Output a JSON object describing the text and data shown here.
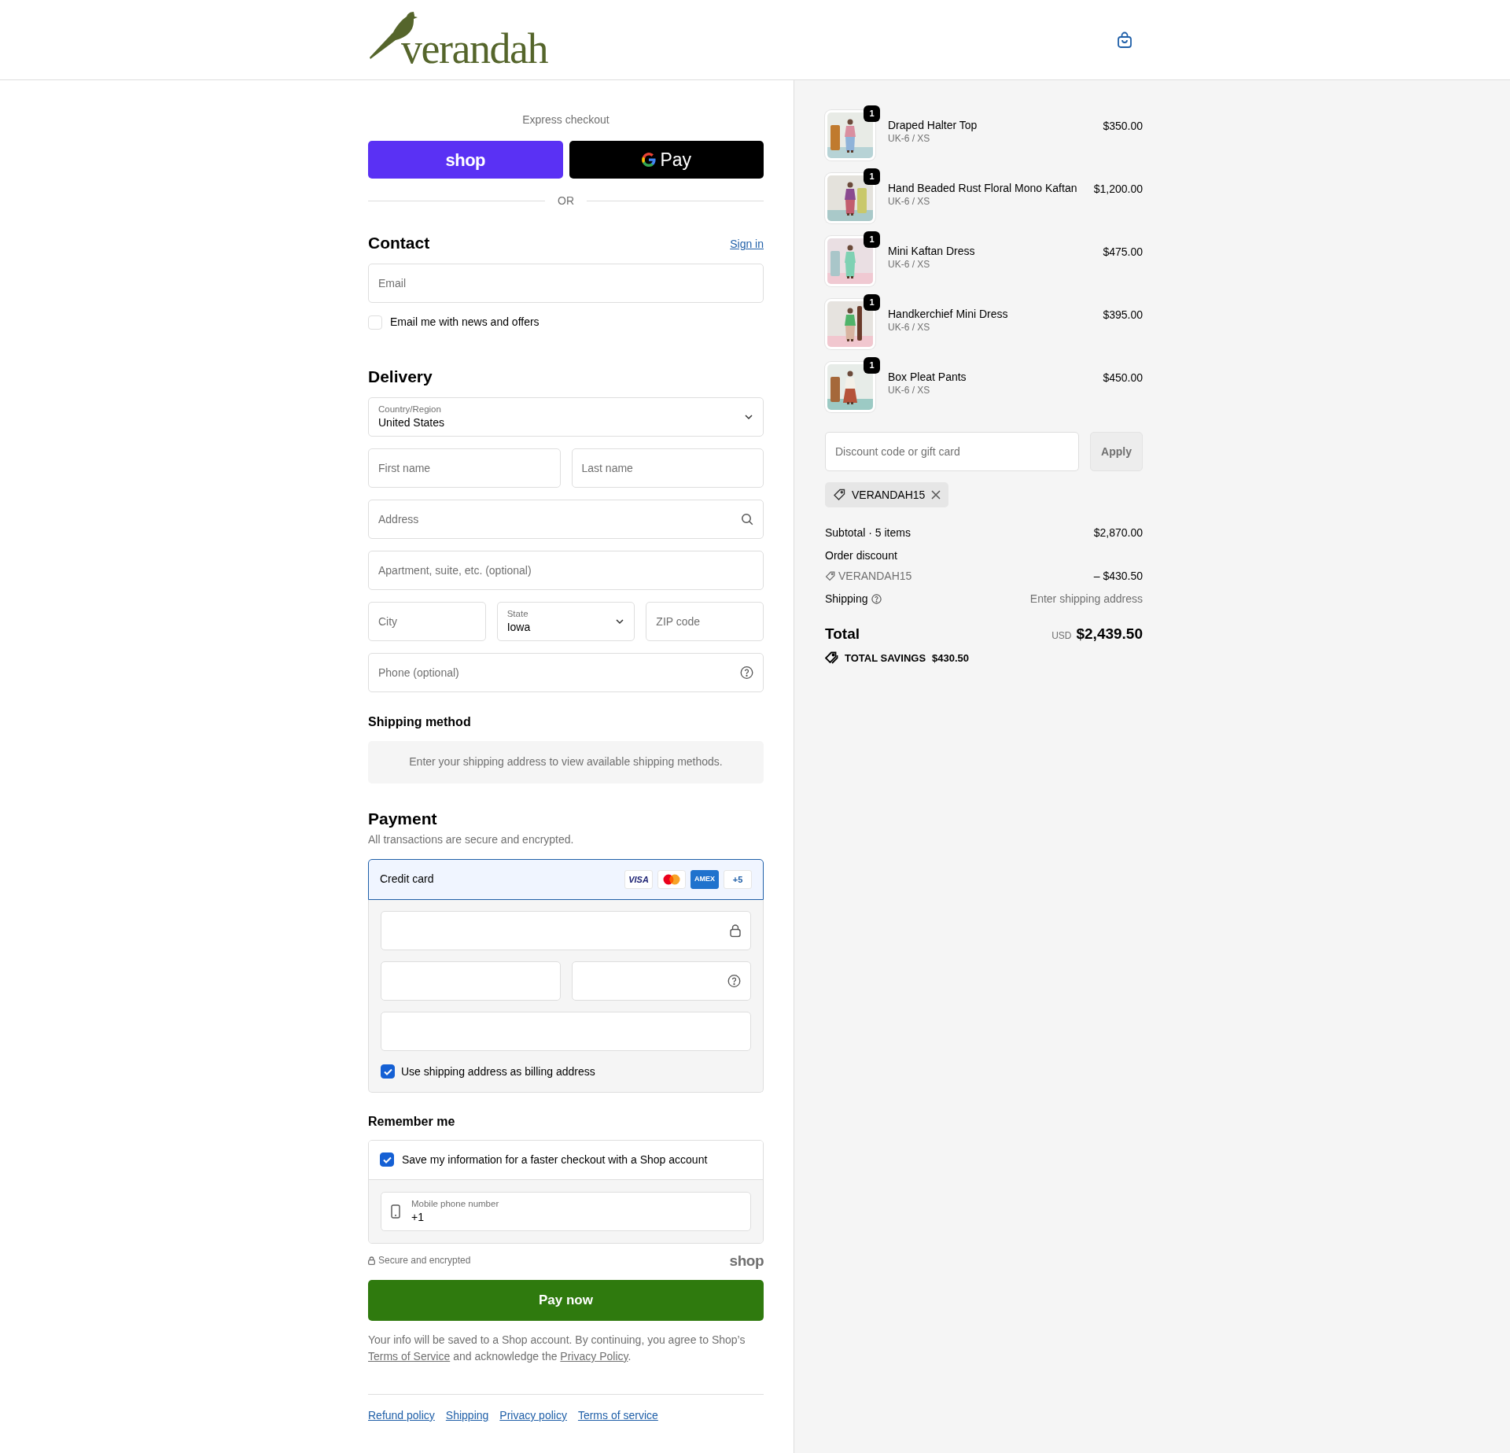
{
  "header": {
    "logo": "verandah"
  },
  "express_checkout": {
    "label": "Express checkout",
    "buttons": [
      {
        "kind": "shop",
        "label": "shop"
      },
      {
        "kind": "gpay",
        "label": "Pay"
      }
    ],
    "divider": "OR"
  },
  "contact": {
    "title": "Contact",
    "sign_in": "Sign in",
    "email": {
      "placeholder": "Email"
    },
    "newsletter": {
      "label": "Email me with news and offers",
      "checked": false
    }
  },
  "delivery": {
    "title": "Delivery",
    "rows": [
      [
        {
          "kind": "select",
          "label": "Country/Region",
          "value": "United States"
        }
      ],
      [
        {
          "kind": "text",
          "placeholder": "First name"
        },
        {
          "kind": "text",
          "placeholder": "Last name"
        }
      ],
      [
        {
          "kind": "search",
          "placeholder": "Address"
        }
      ],
      [
        {
          "kind": "text",
          "placeholder": "Apartment, suite, etc. (optional)"
        }
      ],
      [
        {
          "kind": "text",
          "placeholder": "City"
        },
        {
          "kind": "select",
          "label": "State",
          "value": "Iowa"
        },
        {
          "kind": "text",
          "placeholder": "ZIP code"
        }
      ],
      [
        {
          "kind": "help",
          "placeholder": "Phone (optional)"
        }
      ]
    ]
  },
  "shipping_method": {
    "title": "Shipping method",
    "message": "Enter your shipping address to view available shipping methods."
  },
  "payment": {
    "title": "Payment",
    "subtitle": "All transactions are secure and encrypted.",
    "method": {
      "label": "Credit card",
      "selected": true,
      "brands": [
        {
          "kind": "visa",
          "label": "VISA"
        },
        {
          "kind": "mastercard"
        },
        {
          "kind": "amex",
          "label": "AMEX"
        },
        {
          "kind": "more",
          "label": "+5"
        }
      ]
    },
    "card_fields": [
      [
        {
          "kind": "lock"
        }
      ],
      [
        {
          "kind": "plain"
        },
        {
          "kind": "help"
        }
      ],
      [
        {
          "kind": "plain"
        }
      ]
    ],
    "billing": {
      "label": "Use shipping address as billing address",
      "checked": true
    }
  },
  "remember_me": {
    "title": "Remember me",
    "save": {
      "label": "Save my information for a faster checkout with a Shop account",
      "checked": true
    },
    "phone": {
      "label": "Mobile phone number",
      "value": "+1"
    },
    "secure": "Secure and encrypted",
    "shop_mark": "shop"
  },
  "pay_button": "Pay now",
  "legal": [
    {
      "kind": "text",
      "text": "Your info will be saved to a Shop account. By continuing, you agree to Shop’s "
    },
    {
      "kind": "link",
      "text": "Terms of Service"
    },
    {
      "kind": "text",
      "text": " and acknowledge the "
    },
    {
      "kind": "link",
      "text": "Privacy Policy"
    },
    {
      "kind": "text",
      "text": "."
    }
  ],
  "footer_links": [
    "Refund policy",
    "Shipping",
    "Privacy policy",
    "Terms of service"
  ],
  "order_summary": {
    "items": [
      {
        "name": "Draped Halter Top",
        "variant": "UK-6 / XS",
        "price": "$350.00",
        "quantity": "1"
      },
      {
        "name": "Hand Beaded Rust Floral Mono Kaftan",
        "variant": "UK-6 / XS",
        "price": "$1,200.00",
        "quantity": "1"
      },
      {
        "name": "Mini Kaftan Dress",
        "variant": "UK-6 / XS",
        "price": "$475.00",
        "quantity": "1"
      },
      {
        "name": "Handkerchief Mini Dress",
        "variant": "UK-6 / XS",
        "price": "$395.00",
        "quantity": "1"
      },
      {
        "name": "Box Pleat Pants",
        "variant": "UK-6 / XS",
        "price": "$450.00",
        "quantity": "1"
      }
    ],
    "discount": {
      "placeholder": "Discount code or gift card",
      "apply": "Apply",
      "disabled": true
    },
    "applied_codes": [
      "VERANDAH15"
    ],
    "subtotal": {
      "label": "Subtotal · 5 items",
      "value": "$2,870.00"
    },
    "order_discount": {
      "label": "Order discount",
      "code": "VERANDAH15",
      "value": "– $430.50"
    },
    "shipping": {
      "label": "Shipping",
      "value": "Enter shipping address"
    },
    "total": {
      "label": "Total",
      "currency": "USD",
      "value": "$2,439.50"
    },
    "savings": {
      "label": "TOTAL SAVINGS",
      "value": "$430.50"
    }
  }
}
